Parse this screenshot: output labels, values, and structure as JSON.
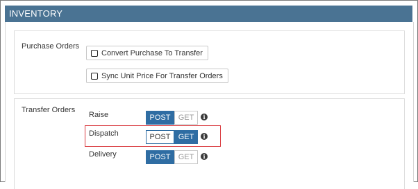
{
  "header": {
    "title": "INVENTORY"
  },
  "purchase_orders": {
    "label": "Purchase Orders",
    "options": [
      {
        "label": "Convert Purchase To Transfer",
        "checked": false
      },
      {
        "label": "Sync Unit Price For Transfer Orders",
        "checked": false
      }
    ]
  },
  "transfer_orders": {
    "label": "Transfer Orders",
    "rows": [
      {
        "label": "Raise",
        "post": "POST",
        "get": "GET",
        "selected": "POST"
      },
      {
        "label": "Dispatch",
        "post": "POST",
        "get": "GET",
        "selected": "GET"
      },
      {
        "label": "Delivery",
        "post": "POST",
        "get": "GET",
        "selected": "POST"
      }
    ],
    "info_glyph": "i"
  },
  "colors": {
    "header_bg": "#4a7393",
    "toggle_active": "#2f6da3",
    "highlight_border": "#d9373b"
  }
}
